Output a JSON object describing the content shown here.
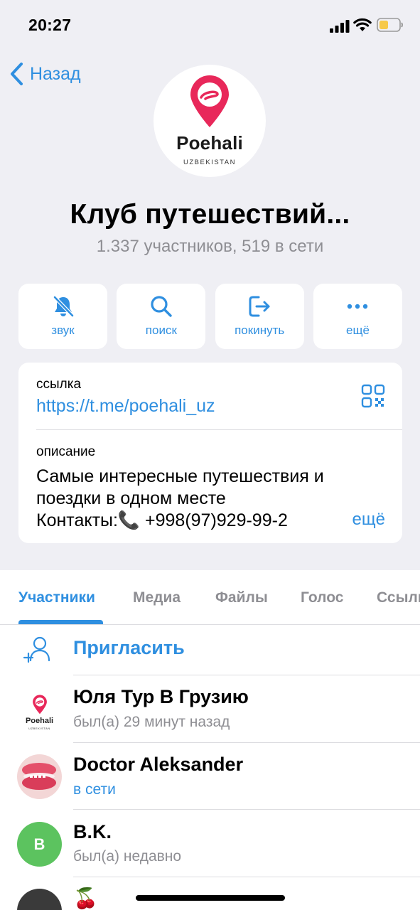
{
  "status_bar": {
    "time": "20:27"
  },
  "nav": {
    "back_label": "Назад"
  },
  "group": {
    "logo_text": "Poehali",
    "logo_sub": "UZBEKISTAN",
    "title": "Клуб путешествий...",
    "subtitle": "1.337 участников, 519 в сети"
  },
  "actions": [
    {
      "label": "звук",
      "icon": "bell-slash-icon"
    },
    {
      "label": "поиск",
      "icon": "search-icon"
    },
    {
      "label": "покинуть",
      "icon": "leave-icon"
    },
    {
      "label": "ещё",
      "icon": "more-icon"
    }
  ],
  "info": {
    "link_label": "ссылка",
    "link_value": "https://t.me/poehali_uz",
    "description_label": "описание",
    "description_lines": [
      "Самые интересные путешествия и",
      "поездки в одном месте",
      "Контакты:📞 +998(97)929-99-2"
    ],
    "more_label": "ещё"
  },
  "tabs": [
    "Участники",
    "Медиа",
    "Файлы",
    "Голос",
    "Ссылки"
  ],
  "active_tab": "Участники",
  "invite_label": "Пригласить",
  "members": [
    {
      "name": "Юля Тур В Грузию",
      "status": "был(а) 29 минут назад",
      "online": false,
      "avatar": "poehali-logo"
    },
    {
      "name": "Doctor Aleksander",
      "status": "в сети",
      "online": true,
      "avatar": "macaron-photo"
    },
    {
      "name": "B.K.",
      "status": "был(а) недавно",
      "online": false,
      "avatar_initial": "B"
    },
    {
      "name": "🍒",
      "status": "",
      "online": false,
      "avatar": "dark-photo"
    }
  ],
  "colors": {
    "accent": "#2f8fe0",
    "logo_pink": "#e8285a",
    "avatar_green": "#5cc35f"
  }
}
